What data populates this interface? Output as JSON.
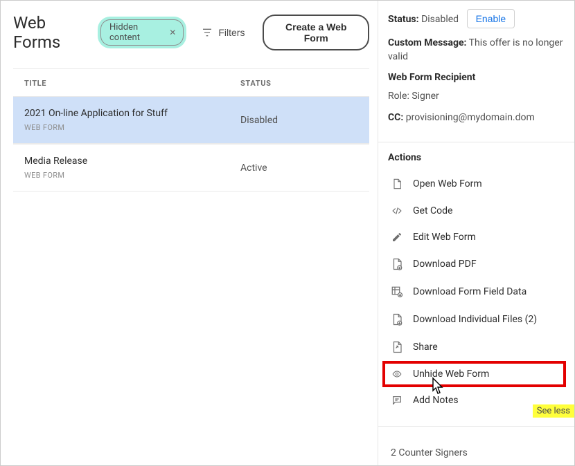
{
  "header": {
    "title": "Web Forms",
    "chip_label": "Hidden content",
    "filters_label": "Filters",
    "create_label": "Create a Web Form"
  },
  "table": {
    "col_title": "TITLE",
    "col_status": "STATUS",
    "rows": [
      {
        "title": "2021 On-line Application for Stuff",
        "sub": "WEB FORM",
        "status": "Disabled",
        "selected": true
      },
      {
        "title": "Media Release",
        "sub": "WEB FORM",
        "status": "Active",
        "selected": false
      }
    ]
  },
  "details": {
    "status_label": "Status:",
    "status_value": "Disabled",
    "enable_label": "Enable",
    "custom_msg_label": "Custom Message:",
    "custom_msg_value": "This offer is no longer valid",
    "recipient_heading": "Web Form Recipient",
    "role_label": "Role:",
    "role_value": "Signer",
    "cc_label": "CC:",
    "cc_value": "provisioning@mydomain.dom"
  },
  "actions": {
    "heading": "Actions",
    "items": [
      {
        "icon": "document-icon",
        "label": "Open Web Form"
      },
      {
        "icon": "code-icon",
        "label": "Get Code"
      },
      {
        "icon": "pencil-icon",
        "label": "Edit Web Form"
      },
      {
        "icon": "download-pdf-icon",
        "label": "Download PDF"
      },
      {
        "icon": "download-form-icon",
        "label": "Download Form Field Data"
      },
      {
        "icon": "download-files-icon",
        "label": "Download Individual Files (2)"
      },
      {
        "icon": "share-icon",
        "label": "Share"
      },
      {
        "icon": "eye-icon",
        "label": "Unhide Web Form"
      },
      {
        "icon": "note-icon",
        "label": "Add Notes"
      }
    ],
    "see_less": "See less",
    "counter_signers": "2 Counter Signers"
  }
}
